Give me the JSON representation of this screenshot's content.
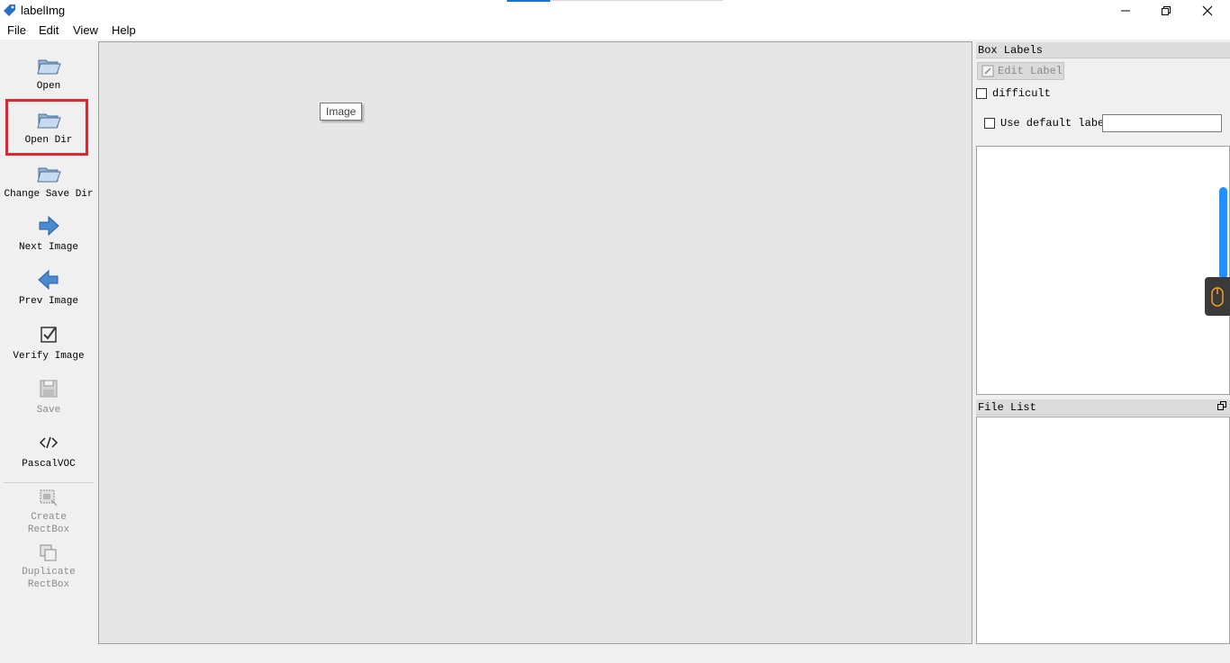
{
  "window": {
    "title": "labelImg",
    "app_icon": "tag-icon",
    "controls": {
      "minimize": "minimize-icon",
      "maximize": "restore-icon",
      "close": "close-icon"
    }
  },
  "menu": {
    "items": [
      "File",
      "Edit",
      "View",
      "Help"
    ]
  },
  "toolbar": {
    "items": [
      {
        "label": "Open",
        "icon": "folder-open-icon",
        "enabled": true
      },
      {
        "label": "Open Dir",
        "icon": "folder-open-icon",
        "enabled": true,
        "highlighted": true
      },
      {
        "label": "Change Save Dir",
        "icon": "folder-open-icon",
        "enabled": true
      },
      {
        "label": "Next Image",
        "icon": "arrow-right-icon",
        "enabled": true
      },
      {
        "label": "Prev Image",
        "icon": "arrow-left-icon",
        "enabled": true
      },
      {
        "label": "Verify Image",
        "icon": "checkbox-icon",
        "enabled": true
      },
      {
        "label": "Save",
        "icon": "floppy-disk-icon",
        "enabled": false
      },
      {
        "label": "PascalVOC",
        "icon": "code-icon",
        "enabled": true
      },
      {
        "label": "Create\nRectBox",
        "icon": "create-rectbox-icon",
        "enabled": false
      },
      {
        "label": "Duplicate\nRectBox",
        "icon": "duplicate-rectbox-icon",
        "enabled": false
      }
    ],
    "more_icon": "double-chevron-down-icon"
  },
  "canvas": {
    "tooltip": "Image"
  },
  "box_labels": {
    "title": "Box Labels",
    "edit_label": "Edit Label",
    "difficult": "difficult",
    "use_default_label": "Use default label",
    "default_label_value": ""
  },
  "file_list": {
    "title": "File List",
    "float_icon": "undock-icon"
  },
  "colors": {
    "highlight": "#e3262d",
    "accent": "#1e90ff"
  }
}
